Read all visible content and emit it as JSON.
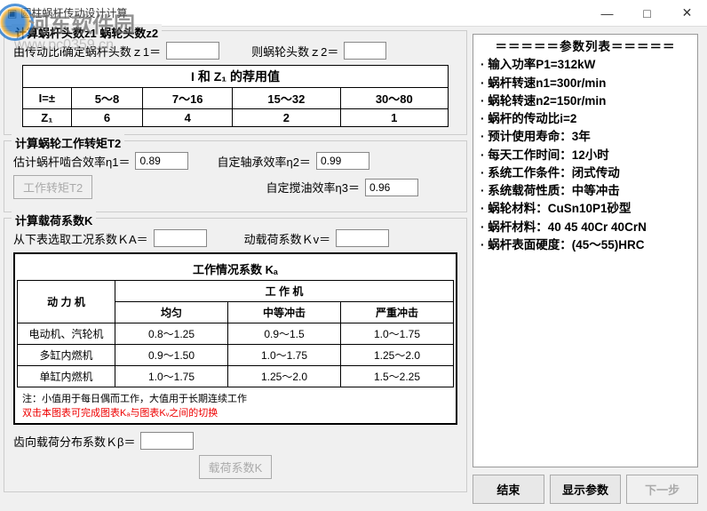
{
  "window": {
    "title": "圆柱蜗杆传动设计计算",
    "minimize": "—",
    "maximize": "□",
    "close": "✕"
  },
  "watermark": {
    "text": "河东软件园",
    "url": "www.pc0359.cn"
  },
  "group1": {
    "title": "计算蜗杆头数z1 蜗轮头数z2",
    "label_z1": "由传动比i确定蜗杆头数ｚ1＝",
    "label_z2": "则蜗轮头数ｚ2＝",
    "table_title": "I 和 Z₁ 的荐用值",
    "rows": [
      [
        "I=±",
        "5～8",
        "7～16",
        "15～32",
        "30～80"
      ],
      [
        "Z₁",
        "6",
        "4",
        "2",
        "1"
      ]
    ]
  },
  "group2": {
    "title": "计算蜗轮工作转矩T2",
    "label_eta1": "估计蜗杆啮合效率η1＝",
    "val_eta1": "0.89",
    "label_eta2": "自定轴承效率η2＝",
    "val_eta2": "0.99",
    "btn_t2": "工作转矩T2",
    "label_eta3": "自定搅油效率η3＝",
    "val_eta3": "0.96"
  },
  "group3": {
    "title": "计算载荷系数K",
    "label_ka": "从下表选取工况系数ＫA＝",
    "label_kv": "动载荷系数Ｋv＝",
    "ka_title": "工作情况系数 Kₐ",
    "ka_header_col": "动 力 机",
    "ka_header_group": "工 作 机",
    "ka_cols": [
      "均匀",
      "中等冲击",
      "严重冲击"
    ],
    "ka_rows": [
      {
        "label": "电动机、汽轮机",
        "vals": [
          "0.8～1.25",
          "0.9～1.5",
          "1.0～1.75"
        ]
      },
      {
        "label": "多缸内燃机",
        "vals": [
          "0.9～1.50",
          "1.0～1.75",
          "1.25～2.0"
        ]
      },
      {
        "label": "单缸内燃机",
        "vals": [
          "1.0～1.75",
          "1.25～2.0",
          "1.5～2.25"
        ]
      }
    ],
    "ka_note1": "注：小值用于每日偶而工作，大值用于长期连续工作",
    "ka_note2": "双击本图表可完成图表Kₐ与图表Kᵥ之间的切换",
    "label_kbeta": "齿向载荷分布系数Ｋβ＝",
    "btn_k": "载荷系数K"
  },
  "params": {
    "header": "＝＝＝＝＝参数列表＝＝＝＝＝",
    "items": [
      "输入功率P1=312kW",
      "蜗杆转速n1=300r/min",
      "蜗轮转速n2=150r/min",
      "蜗杆的传动比i=2",
      "预计使用寿命：3年",
      "每天工作时间：12小时",
      "系统工作条件：闭式传动",
      "系统载荷性质：中等冲击",
      "蜗轮材料：CuSn10P1砂型",
      "蜗杆材料：40  45  40Cr  40CrN",
      "蜗杆表面硬度：(45～55)HRC"
    ]
  },
  "buttons": {
    "end": "结束",
    "show_params": "显示参数",
    "next": "下一步"
  }
}
